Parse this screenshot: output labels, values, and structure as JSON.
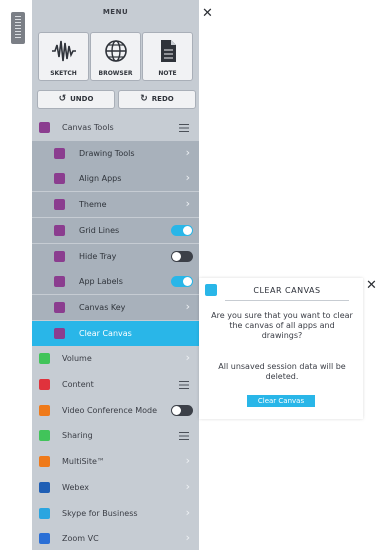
{
  "menu": {
    "title": "MENU",
    "close": "✕",
    "tools": [
      {
        "label": "SKETCH",
        "icon": "sketch-waveform-icon"
      },
      {
        "label": "BROWSER",
        "icon": "globe-icon"
      },
      {
        "label": "NOTE",
        "icon": "note-icon"
      }
    ],
    "undo": {
      "label": "UNDO",
      "icon": "undo-icon"
    },
    "redo": {
      "label": "REDO",
      "icon": "redo-icon"
    }
  },
  "rows": [
    {
      "label": "Canvas Tools",
      "color": "#8b3d8f",
      "control": "hamburger",
      "sub": false
    },
    {
      "label": "Drawing Tools",
      "color": "#8b3d8f",
      "control": "chevron",
      "sub": true
    },
    {
      "label": "Align Apps",
      "color": "#8b3d8f",
      "control": "chevron",
      "sub": true
    },
    {
      "label": "Theme",
      "color": "#8b3d8f",
      "control": "chevron",
      "sub": true
    },
    {
      "label": "Grid Lines",
      "color": "#8b3d8f",
      "control": "toggle",
      "on": true,
      "sub": true
    },
    {
      "label": "Hide Tray",
      "color": "#8b3d8f",
      "control": "toggle",
      "on": false,
      "sub": true
    },
    {
      "label": "App Labels",
      "color": "#8b3d8f",
      "control": "toggle",
      "on": true,
      "sub": true
    },
    {
      "label": "Canvas Key",
      "color": "#8b3d8f",
      "control": "chevron",
      "sub": true
    },
    {
      "label": "Clear Canvas",
      "color": "#8b3d8f",
      "control": "none",
      "sub": true,
      "active": true
    },
    {
      "label": "Volume",
      "color": "#41c45a",
      "control": "chevron",
      "sub": false
    },
    {
      "label": "Content",
      "color": "#e0323c",
      "control": "hamburger",
      "sub": false
    },
    {
      "label": "Video Conference Mode",
      "color": "#ef7a1a",
      "control": "toggle",
      "on": false,
      "sub": false
    },
    {
      "label": "Sharing",
      "color": "#41c45a",
      "control": "hamburger",
      "sub": false
    },
    {
      "label": "MultiSite™",
      "color": "#ef7a1a",
      "control": "chevron",
      "sub": false
    },
    {
      "label": "Webex",
      "color": "#1f5fb5",
      "control": "chevron",
      "sub": false
    },
    {
      "label": "Skype for Business",
      "color": "#2aa5e0",
      "control": "chevron",
      "sub": false
    },
    {
      "label": "Zoom VC",
      "color": "#2a6fd6",
      "control": "chevron",
      "sub": false
    }
  ],
  "colors": {
    "accent": "#29b6e8",
    "toggle_off": "#3c4048"
  },
  "popup": {
    "close": "✕",
    "title": "CLEAR CANVAS",
    "message1": "Are you sure that you want to clear the canvas of all apps and drawings?",
    "message2": "All unsaved session data will be deleted.",
    "button": "Clear Canvas"
  }
}
